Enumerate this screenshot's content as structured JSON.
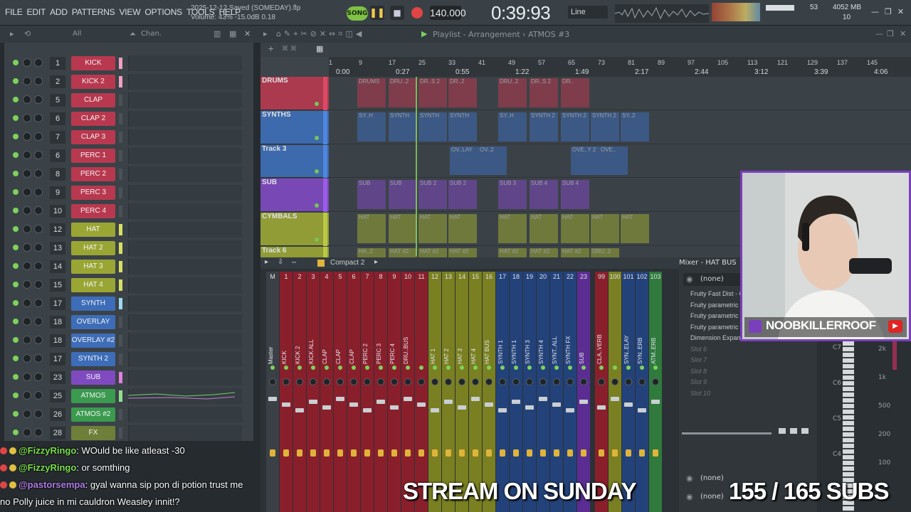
{
  "menu": [
    "FILE",
    "EDIT",
    "ADD",
    "PATTERNS",
    "VIEW",
    "OPTIONS",
    "TOOLS",
    "HELP"
  ],
  "project": {
    "saved": "2025-12-12 Saved (SOMEDAY).flp",
    "volume": "Volume: 43%  -15.0dB  0.18"
  },
  "transport": {
    "mode": "SONG",
    "tempo": "140.000",
    "time": "0:39:93",
    "snap": "Line"
  },
  "resources": {
    "cpu_value": "53",
    "ram": "4052 MB",
    "voices": "10"
  },
  "toolbar2": {
    "filter": "All",
    "channels": "Chan.",
    "playlist_title": "Playlist - Arrangement › ATMOS #3"
  },
  "channels": [
    {
      "n": "1",
      "name": "KICK",
      "color": "#b8394f"
    },
    {
      "n": "2",
      "name": "KICK 2",
      "color": "#b8394f"
    },
    {
      "n": "5",
      "name": "CLAP",
      "color": "#b8394f"
    },
    {
      "n": "6",
      "name": "CLAP 2",
      "color": "#b8394f"
    },
    {
      "n": "7",
      "name": "CLAP 3",
      "color": "#b8394f"
    },
    {
      "n": "6",
      "name": "PERC 1",
      "color": "#b8394f"
    },
    {
      "n": "8",
      "name": "PERC 2",
      "color": "#b8394f"
    },
    {
      "n": "9",
      "name": "PERC 3",
      "color": "#b8394f"
    },
    {
      "n": "10",
      "name": "PERC 4",
      "color": "#b8394f"
    },
    {
      "n": "12",
      "name": "HAT",
      "color": "#9aa634"
    },
    {
      "n": "13",
      "name": "HAT 2",
      "color": "#9aa634"
    },
    {
      "n": "14",
      "name": "HAT 3",
      "color": "#9aa634"
    },
    {
      "n": "15",
      "name": "HAT 4",
      "color": "#9aa634"
    },
    {
      "n": "17",
      "name": "SYNTH",
      "color": "#3d6db8"
    },
    {
      "n": "18",
      "name": "OVERLAY",
      "color": "#3d6db8"
    },
    {
      "n": "18",
      "name": "OVERLAY #2",
      "color": "#3d6db8"
    },
    {
      "n": "17",
      "name": "SYNTH 2",
      "color": "#3d6db8"
    },
    {
      "n": "23",
      "name": "SUB",
      "color": "#7f4ac0"
    },
    {
      "n": "25",
      "name": "ATMOS",
      "color": "#3a9a4e"
    },
    {
      "n": "26",
      "name": "ATMOS #2",
      "color": "#3a9a4e"
    },
    {
      "n": "28",
      "name": "FX",
      "color": "#6e7f3a"
    }
  ],
  "ruler": {
    "bars": [
      "1",
      "9",
      "17",
      "25",
      "33",
      "41",
      "49",
      "57",
      "65",
      "73",
      "81",
      "89",
      "97",
      "105",
      "113",
      "121",
      "129",
      "137",
      "145"
    ],
    "times": [
      "0:00",
      "0:27",
      "0:55",
      "1:22",
      "1:49",
      "2:17",
      "2:44",
      "3:12",
      "3:39",
      "4:06"
    ]
  },
  "tracks": [
    {
      "name": "DRUMS",
      "color": "#b8394f",
      "clips": [
        "DRUMS",
        "DRU..2",
        "DR..S 2",
        "DR..2",
        "DRU..2",
        "DR..S 2",
        "DR.."
      ]
    },
    {
      "name": "SYNTHS",
      "color": "#3d6db8",
      "clips": [
        "SY..H",
        "SYNTH",
        "SYNTH",
        "SYNTH",
        "SY..H",
        "SYNTH 2",
        "SYNTH 2",
        "SYNTH 2",
        "SY..2"
      ]
    },
    {
      "name": "Track 3",
      "color": "#3d6db8",
      "clips": [
        "OV..LAY",
        "OV..2",
        "OVE..Y 2",
        "OVE.."
      ]
    },
    {
      "name": "SUB",
      "color": "#7f4ac0",
      "clips": [
        "SUB",
        "SUB",
        "SUB 2",
        "SUB 2",
        "SUB 3",
        "SUB 4",
        "SUB 4"
      ]
    },
    {
      "name": "CYMBALS",
      "color": "#9aa634",
      "clips": [
        "HAT",
        "HAT",
        "HAT",
        "HAT",
        "HAT",
        "HAT",
        "HAT",
        "HAT",
        "HAT"
      ]
    },
    {
      "name": "Track 6",
      "color": "#9aa634",
      "clips": [
        "HA..2",
        "HAT #2",
        "HAT #2",
        "HAT #2",
        "HAT #2",
        "HAT #2",
        "HAT #2",
        "DRU..2"
      ]
    }
  ],
  "mixer": {
    "view": "Compact 2",
    "title": "Mixer - HAT BUS",
    "strips": [
      {
        "n": "M",
        "name": "Master",
        "color": "#3a4045"
      },
      {
        "n": "1",
        "name": "KICK",
        "color": "#8a1f2c"
      },
      {
        "n": "2",
        "name": "KICK 2",
        "color": "#8a1f2c"
      },
      {
        "n": "3",
        "name": "KICK ALL",
        "color": "#8a1f2c"
      },
      {
        "n": "4",
        "name": "CLAP",
        "color": "#8a1f2c"
      },
      {
        "n": "5",
        "name": "CLAP",
        "color": "#8a1f2c"
      },
      {
        "n": "6",
        "name": "CLAP",
        "color": "#8a1f2c"
      },
      {
        "n": "7",
        "name": "PERC 2",
        "color": "#8a1f2c"
      },
      {
        "n": "8",
        "name": "PERC 3",
        "color": "#8a1f2c"
      },
      {
        "n": "9",
        "name": "PERC 4",
        "color": "#8a1f2c"
      },
      {
        "n": "10",
        "name": "DRU..BUS",
        "color": "#8a1f2c"
      },
      {
        "n": "11",
        "name": "",
        "color": "#8a1f2c"
      },
      {
        "n": "12",
        "name": "HAT 1",
        "color": "#7a8021"
      },
      {
        "n": "13",
        "name": "HAT 2",
        "color": "#7a8021"
      },
      {
        "n": "14",
        "name": "HAT 3",
        "color": "#7a8021"
      },
      {
        "n": "15",
        "name": "HAT 4",
        "color": "#7a8021"
      },
      {
        "n": "16",
        "name": "HAT BUS",
        "color": "#7a8021"
      },
      {
        "n": "17",
        "name": "SYNTH 1",
        "color": "#23427a"
      },
      {
        "n": "18",
        "name": "SYNTH 1",
        "color": "#23427a"
      },
      {
        "n": "19",
        "name": "SYNTH 3",
        "color": "#23427a"
      },
      {
        "n": "20",
        "name": "SYNTH 4",
        "color": "#23427a"
      },
      {
        "n": "21",
        "name": "SYNT..ALL",
        "color": "#23427a"
      },
      {
        "n": "22",
        "name": "SYNTH FX",
        "color": "#23427a"
      },
      {
        "n": "23",
        "name": "SUB",
        "color": "#5b2d93"
      },
      {
        "n": "99",
        "name": "CLA..VERB",
        "color": "#8a1f2c"
      },
      {
        "n": "100",
        "name": "",
        "color": "#7a8021"
      },
      {
        "n": "101",
        "name": "SYN..ELAY",
        "color": "#23427a"
      },
      {
        "n": "102",
        "name": "SYN..ERB",
        "color": "#23427a"
      },
      {
        "n": "103",
        "name": "ATM..ERB",
        "color": "#2f7a3c"
      }
    ],
    "input": "(none)",
    "slots": [
      "Fruity Fast Dist - Co",
      "Fruity parametric E",
      "Fruity parametric E",
      "Fruity parametric E",
      "Dimension Expander",
      "Slot 6",
      "Slot 7",
      "Slot 8",
      "Slot 9",
      "Slot 10"
    ],
    "output": "(none)",
    "output2": "(none)"
  },
  "piano": [
    "C7",
    "C6",
    "C5",
    "C4",
    "C3"
  ],
  "piano_right": [
    "2k",
    "1k",
    "500",
    "200",
    "100"
  ],
  "webcam": {
    "channel": "NOOBKILLERROOF"
  },
  "chat": [
    {
      "user": "@FizzyRingo",
      "text": ": WOuld be like atleast -30"
    },
    {
      "user": "@FizzyRingo",
      "text": ": or somthing"
    },
    {
      "user": "@pastorsempa",
      "text": ": gyal wanna sip pon di potion trust me"
    },
    {
      "user": "",
      "text": "no Polly juice in mi cauldron Weasley innit!?"
    }
  ],
  "overlays": {
    "stream": "STREAM ON SUNDAY",
    "subs": "155 / 165  SUBS"
  }
}
